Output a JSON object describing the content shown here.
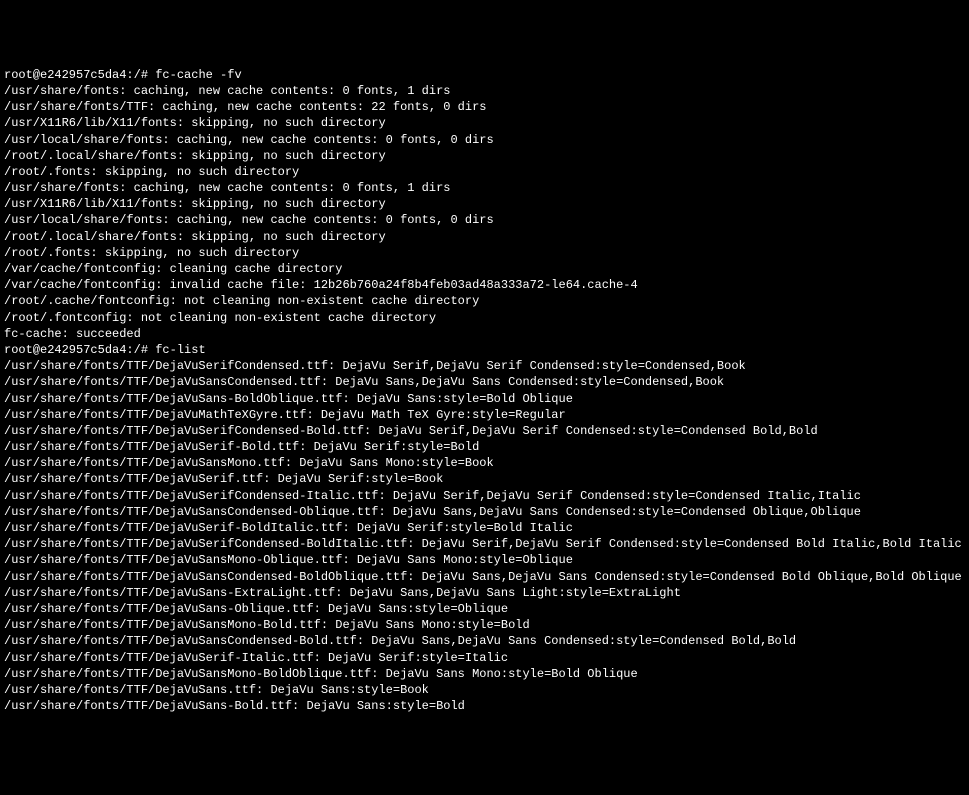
{
  "prompt1": {
    "prompt": "root@e242957c5da4:/# ",
    "command": "fc-cache -fv"
  },
  "output1": [
    "/usr/share/fonts: caching, new cache contents: 0 fonts, 1 dirs",
    "/usr/share/fonts/TTF: caching, new cache contents: 22 fonts, 0 dirs",
    "/usr/X11R6/lib/X11/fonts: skipping, no such directory",
    "/usr/local/share/fonts: caching, new cache contents: 0 fonts, 0 dirs",
    "/root/.local/share/fonts: skipping, no such directory",
    "/root/.fonts: skipping, no such directory",
    "/usr/share/fonts: caching, new cache contents: 0 fonts, 1 dirs",
    "/usr/X11R6/lib/X11/fonts: skipping, no such directory",
    "/usr/local/share/fonts: caching, new cache contents: 0 fonts, 0 dirs",
    "/root/.local/share/fonts: skipping, no such directory",
    "/root/.fonts: skipping, no such directory",
    "/var/cache/fontconfig: cleaning cache directory",
    "/var/cache/fontconfig: invalid cache file: 12b26b760a24f8b4feb03ad48a333a72-le64.cache-4",
    "/root/.cache/fontconfig: not cleaning non-existent cache directory",
    "/root/.fontconfig: not cleaning non-existent cache directory",
    "fc-cache: succeeded"
  ],
  "prompt2": {
    "prompt": "root@e242957c5da4:/# ",
    "command": "fc-list"
  },
  "output2": [
    "/usr/share/fonts/TTF/DejaVuSerifCondensed.ttf: DejaVu Serif,DejaVu Serif Condensed:style=Condensed,Book",
    "/usr/share/fonts/TTF/DejaVuSansCondensed.ttf: DejaVu Sans,DejaVu Sans Condensed:style=Condensed,Book",
    "/usr/share/fonts/TTF/DejaVuSans-BoldOblique.ttf: DejaVu Sans:style=Bold Oblique",
    "/usr/share/fonts/TTF/DejaVuMathTeXGyre.ttf: DejaVu Math TeX Gyre:style=Regular",
    "/usr/share/fonts/TTF/DejaVuSerifCondensed-Bold.ttf: DejaVu Serif,DejaVu Serif Condensed:style=Condensed Bold,Bold",
    "/usr/share/fonts/TTF/DejaVuSerif-Bold.ttf: DejaVu Serif:style=Bold",
    "/usr/share/fonts/TTF/DejaVuSansMono.ttf: DejaVu Sans Mono:style=Book",
    "/usr/share/fonts/TTF/DejaVuSerif.ttf: DejaVu Serif:style=Book",
    "/usr/share/fonts/TTF/DejaVuSerifCondensed-Italic.ttf: DejaVu Serif,DejaVu Serif Condensed:style=Condensed Italic,Italic",
    "/usr/share/fonts/TTF/DejaVuSansCondensed-Oblique.ttf: DejaVu Sans,DejaVu Sans Condensed:style=Condensed Oblique,Oblique",
    "/usr/share/fonts/TTF/DejaVuSerif-BoldItalic.ttf: DejaVu Serif:style=Bold Italic",
    "/usr/share/fonts/TTF/DejaVuSerifCondensed-BoldItalic.ttf: DejaVu Serif,DejaVu Serif Condensed:style=Condensed Bold Italic,Bold Italic",
    "/usr/share/fonts/TTF/DejaVuSansMono-Oblique.ttf: DejaVu Sans Mono:style=Oblique",
    "/usr/share/fonts/TTF/DejaVuSansCondensed-BoldOblique.ttf: DejaVu Sans,DejaVu Sans Condensed:style=Condensed Bold Oblique,Bold Oblique",
    "/usr/share/fonts/TTF/DejaVuSans-ExtraLight.ttf: DejaVu Sans,DejaVu Sans Light:style=ExtraLight",
    "/usr/share/fonts/TTF/DejaVuSans-Oblique.ttf: DejaVu Sans:style=Oblique",
    "/usr/share/fonts/TTF/DejaVuSansMono-Bold.ttf: DejaVu Sans Mono:style=Bold",
    "/usr/share/fonts/TTF/DejaVuSansCondensed-Bold.ttf: DejaVu Sans,DejaVu Sans Condensed:style=Condensed Bold,Bold",
    "/usr/share/fonts/TTF/DejaVuSerif-Italic.ttf: DejaVu Serif:style=Italic",
    "/usr/share/fonts/TTF/DejaVuSansMono-BoldOblique.ttf: DejaVu Sans Mono:style=Bold Oblique",
    "/usr/share/fonts/TTF/DejaVuSans.ttf: DejaVu Sans:style=Book",
    "/usr/share/fonts/TTF/DejaVuSans-Bold.ttf: DejaVu Sans:style=Bold"
  ]
}
